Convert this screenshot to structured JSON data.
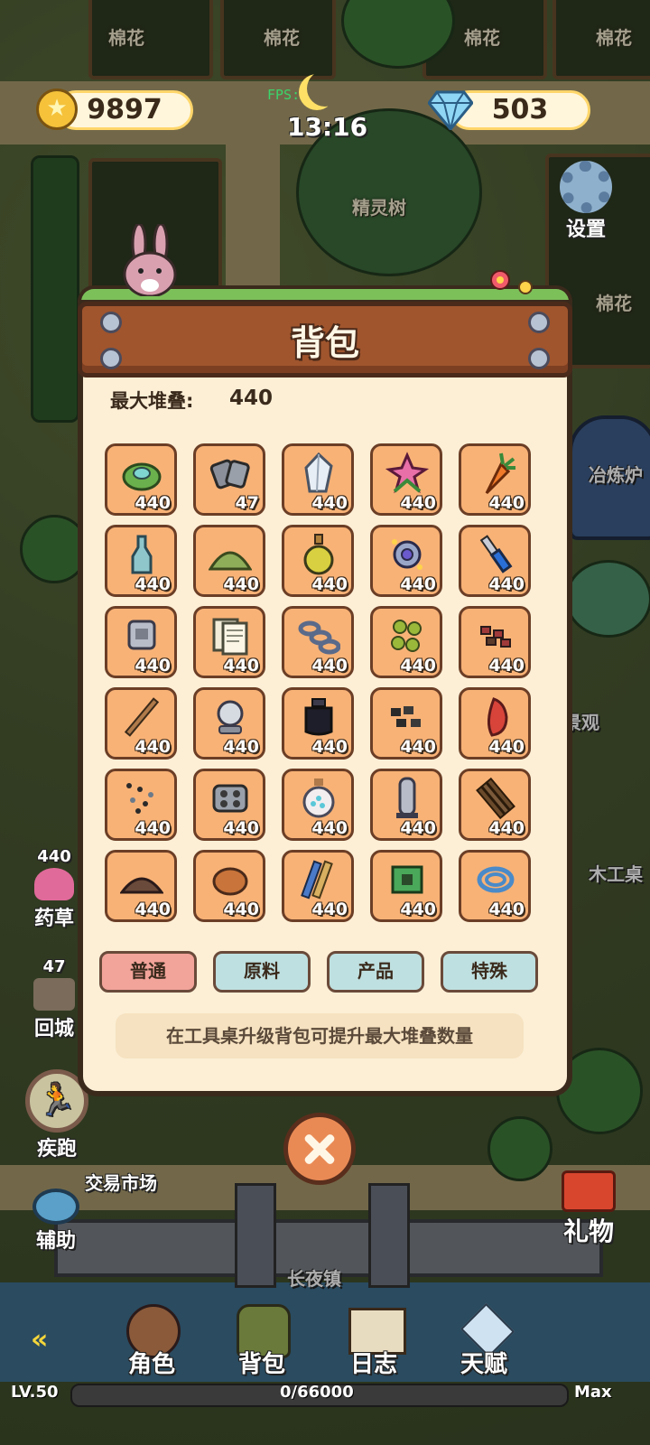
{
  "hud": {
    "coins": "9897",
    "gems": "503",
    "fps": "FPS:",
    "time": "13:16"
  },
  "world": {
    "field_label": "棉花",
    "spirit_tree": "精灵树",
    "settings": "设置",
    "smelter": "冶炼炉",
    "landscape": "景观",
    "workbench": "木工桌",
    "herb_count": "440",
    "herb_label": "药草",
    "return_count": "47",
    "return_label": "回城",
    "sprint": "疾跑",
    "market": "交易市场",
    "assist": "辅助",
    "gift": "礼物",
    "town": "长夜镇"
  },
  "modal": {
    "title": "背包",
    "max_stack_label": "最大堆叠:",
    "max_stack_value": "440",
    "items": [
      {
        "icon": "slime-leaf-icon",
        "qty": "440"
      },
      {
        "icon": "log-bundle-icon",
        "qty": "47"
      },
      {
        "icon": "crystal-icon",
        "qty": "440"
      },
      {
        "icon": "pink-flower-icon",
        "qty": "440"
      },
      {
        "icon": "carrot-icon",
        "qty": "440"
      },
      {
        "icon": "bottle-icon",
        "qty": "440"
      },
      {
        "icon": "sand-pile-icon",
        "qty": "440"
      },
      {
        "icon": "potion-icon",
        "qty": "440"
      },
      {
        "icon": "gear-part-icon",
        "qty": "440"
      },
      {
        "icon": "chisel-icon",
        "qty": "440"
      },
      {
        "icon": "machine-part-icon",
        "qty": "440"
      },
      {
        "icon": "paper-icon",
        "qty": "440"
      },
      {
        "icon": "chain-icon",
        "qty": "440"
      },
      {
        "icon": "seeds-icon",
        "qty": "440"
      },
      {
        "icon": "ore-bits-icon",
        "qty": "440"
      },
      {
        "icon": "stick-icon",
        "qty": "440"
      },
      {
        "icon": "pearl-icon",
        "qty": "440"
      },
      {
        "icon": "ink-bottle-icon",
        "qty": "440"
      },
      {
        "icon": "coal-icon",
        "qty": "440"
      },
      {
        "icon": "red-gem-icon",
        "qty": "440"
      },
      {
        "icon": "gravel-icon",
        "qty": "440"
      },
      {
        "icon": "mold-icon",
        "qty": "440"
      },
      {
        "icon": "bead-jar-icon",
        "qty": "440"
      },
      {
        "icon": "pillar-icon",
        "qty": "440"
      },
      {
        "icon": "stick-bundle-icon",
        "qty": "440"
      },
      {
        "icon": "soil-pile-icon",
        "qty": "440"
      },
      {
        "icon": "clay-icon",
        "qty": "440"
      },
      {
        "icon": "scroll-rolls-icon",
        "qty": "440"
      },
      {
        "icon": "chip-icon",
        "qty": "440"
      },
      {
        "icon": "wire-coil-icon",
        "qty": "440"
      }
    ],
    "tabs": [
      "普通",
      "原料",
      "产品",
      "特殊"
    ],
    "hint": "在工具桌升级背包可提升最大堆叠数量"
  },
  "nav": {
    "items": [
      "角色",
      "背包",
      "日志",
      "天赋"
    ],
    "level": "LV.50",
    "xp": "0/66000",
    "max": "Max",
    "xp_progress": 0
  }
}
